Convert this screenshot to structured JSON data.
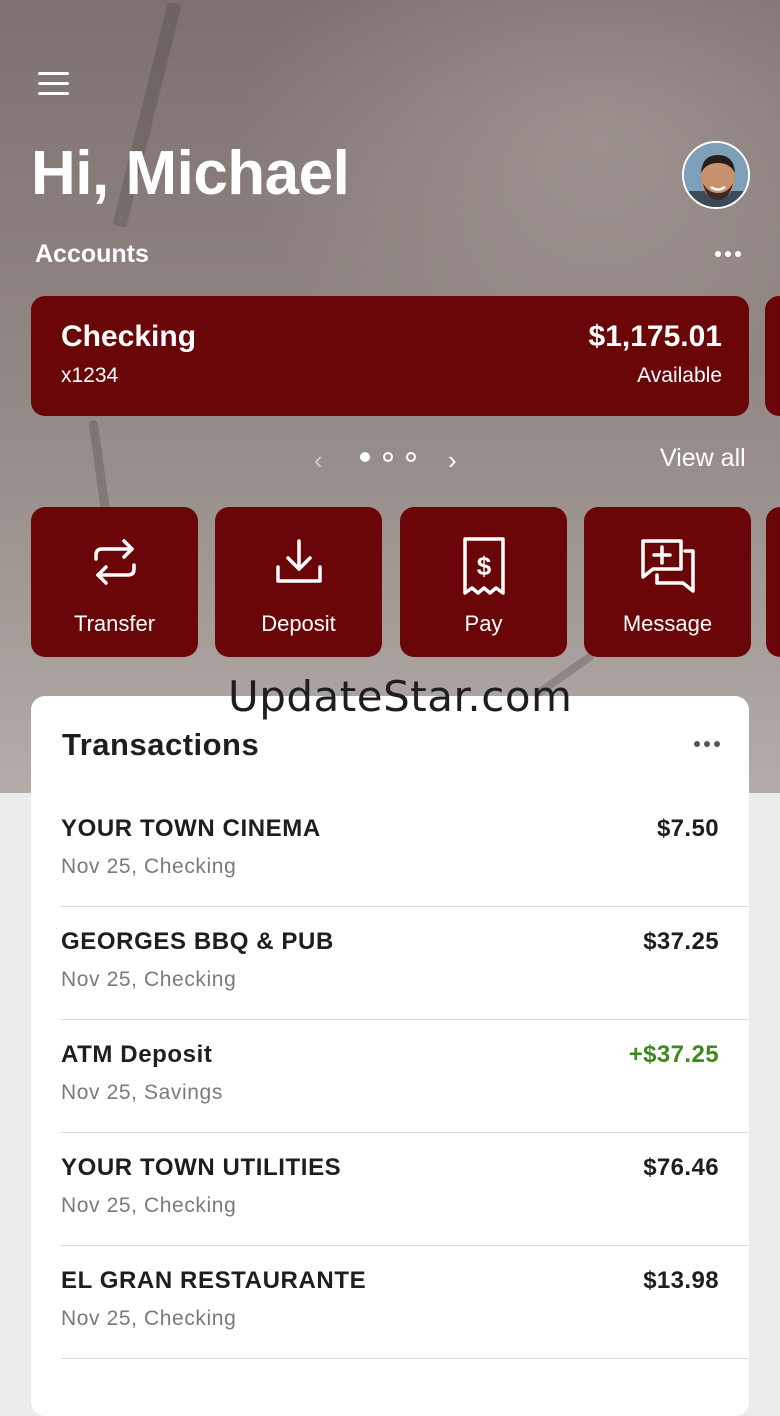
{
  "header": {
    "greeting": "Hi, Michael"
  },
  "accounts": {
    "label": "Accounts",
    "card": {
      "name": "Checking",
      "number": "x1234",
      "balance": "$1,175.01",
      "balance_label": "Available"
    },
    "pager": {
      "pages": 3,
      "current": 1
    },
    "view_all": "View all"
  },
  "actions": [
    {
      "label": "Transfer",
      "icon": "transfer-icon"
    },
    {
      "label": "Deposit",
      "icon": "deposit-icon"
    },
    {
      "label": "Pay",
      "icon": "bill-pay-icon"
    },
    {
      "label": "Message",
      "icon": "message-icon"
    }
  ],
  "watermark": "UpdateStar.com",
  "transactions": {
    "title": "Transactions",
    "items": [
      {
        "name": "YOUR TOWN CINEMA",
        "detail": "Nov 25, Checking",
        "amount": "$7.50"
      },
      {
        "name": "GEORGES BBQ & PUB",
        "detail": "Nov 25, Checking",
        "amount": "$37.25"
      },
      {
        "name": "ATM Deposit",
        "detail": "Nov 25, Savings",
        "amount": "+$37.25"
      },
      {
        "name": "YOUR TOWN UTILITIES",
        "detail": "Nov 25, Checking",
        "amount": "$76.46"
      },
      {
        "name": "EL GRAN RESTAURANTE",
        "detail": "Nov 25, Checking",
        "amount": "$13.98"
      }
    ]
  },
  "colors": {
    "brand": "#6b0608",
    "credit": "#3c8a1e",
    "text": "#1e1e1e",
    "muted": "#7a7a7a"
  }
}
